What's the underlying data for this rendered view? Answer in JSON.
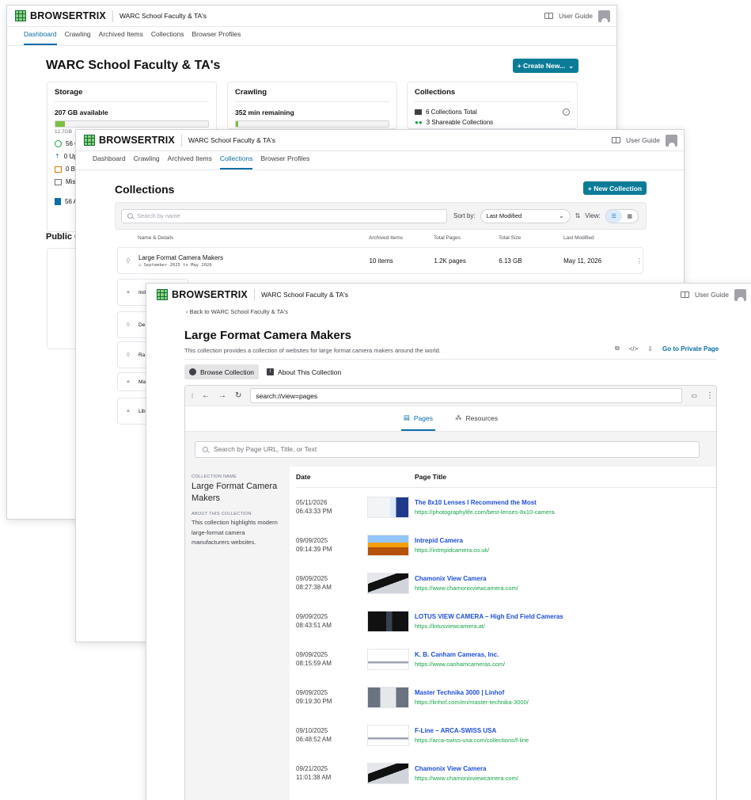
{
  "app": {
    "brand": "BROWSERTRIX",
    "org": "WARC School Faculty & TA's",
    "user_guide": "User Guide"
  },
  "nav": [
    "Dashboard",
    "Crawling",
    "Archived Items",
    "Collections",
    "Browser Profiles"
  ],
  "dashboard": {
    "title": "WARC School Faculty & TA's",
    "create_button": "+ Create New...",
    "storage": {
      "title": "Storage",
      "available": "207 GB available",
      "used_fraction": 0.06,
      "used_label": "12.7GB",
      "lines": [
        "56 C",
        "0 Up",
        "0 Br",
        "Misc",
        "56 A"
      ]
    },
    "crawling": {
      "title": "Crawling",
      "remaining": "352 min remaining",
      "used_fraction": 0.01
    },
    "collections": {
      "title": "Collections",
      "total": "6 Collections Total",
      "shareable": "3 Shareable Collections"
    },
    "public_heading": "Public C"
  },
  "collections_page": {
    "title": "Collections",
    "new_button": "+ New Collection",
    "search_placeholder": "Search by name",
    "sort_label": "Sort by:",
    "sort_value": "Last Modified",
    "view_label": "View:",
    "headers": [
      "Name & Details",
      "Archived Items",
      "Total Pages",
      "Total Size",
      "Last Modified"
    ],
    "first_row": {
      "name": "Large Format Camera Makers",
      "dates": "September 2025 to May 2026",
      "items": "10 items",
      "pages": "1.2K pages",
      "size": "6.13 GB",
      "modified": "May 11, 2026"
    },
    "stub_rows": [
      "Ind",
      "De",
      "Ra",
      "Ma",
      "Lib"
    ]
  },
  "collection_detail": {
    "back": "Back to WARC School Faculty & TA's",
    "title": "Large Format Camera Makers",
    "description": "This collection provides a collection of websites for large format camera makers around the world.",
    "private_link": "Go to Private Page",
    "tab_browse": "Browse Collection",
    "tab_about": "About This Collection",
    "url": "search://view=pages",
    "tab_pages": "Pages",
    "tab_resources": "Resources",
    "search_placeholder": "Search by Page URL, Title, or Text",
    "side": {
      "name_label": "COLLECTION NAME",
      "name": "Large Format Camera Makers",
      "about_label": "ABOUT THIS COLLECTION",
      "about": "This collection highlights modern large-format camera manufacturers websites."
    },
    "col_date": "Date",
    "col_title": "Page Title",
    "pages": [
      {
        "date": "05/11/2026",
        "time": "06:43:33 PM",
        "title": "The 8x10 Lenses I Recommend the Most",
        "url": "https://photographylife.com/best-lenses-8x10-camera",
        "thumb": "light"
      },
      {
        "date": "09/09/2025",
        "time": "09:14:39 PM",
        "title": "Intrepid Camera",
        "url": "https://intrepidcamera.co.uk/",
        "thumb": "orange"
      },
      {
        "date": "09/09/2025",
        "time": "08:27:38 AM",
        "title": "Chamonix View Camera",
        "url": "https://www.chamonixviewcamera.com/",
        "thumb": "mono"
      },
      {
        "date": "09/09/2025",
        "time": "08:43:51 AM",
        "title": "LOTUS VIEW CAMERA – High End Field Cameras",
        "url": "https://lotusviewcamera.at/",
        "thumb": "dark"
      },
      {
        "date": "09/09/2025",
        "time": "08:15:59 AM",
        "title": "K. B. Canham Cameras, Inc.",
        "url": "https://www.canhamcameras.com/",
        "thumb": "white"
      },
      {
        "date": "09/09/2025",
        "time": "09:19:30 PM",
        "title": "Master Technika 3000 | Linhof",
        "url": "https://linhof.com/en/master-technika-3000/",
        "thumb": "grey"
      },
      {
        "date": "09/10/2025",
        "time": "06:48:52 AM",
        "title": "F-Line – ARCA-SWISS USA",
        "url": "https://arca-swiss-usa.com/collections/f-line",
        "thumb": "white"
      },
      {
        "date": "09/21/2025",
        "time": "11:01:38 AM",
        "title": "Chamonix View Camera",
        "url": "https://www.chamonixviewcamera.com/",
        "thumb": "mono"
      }
    ]
  }
}
